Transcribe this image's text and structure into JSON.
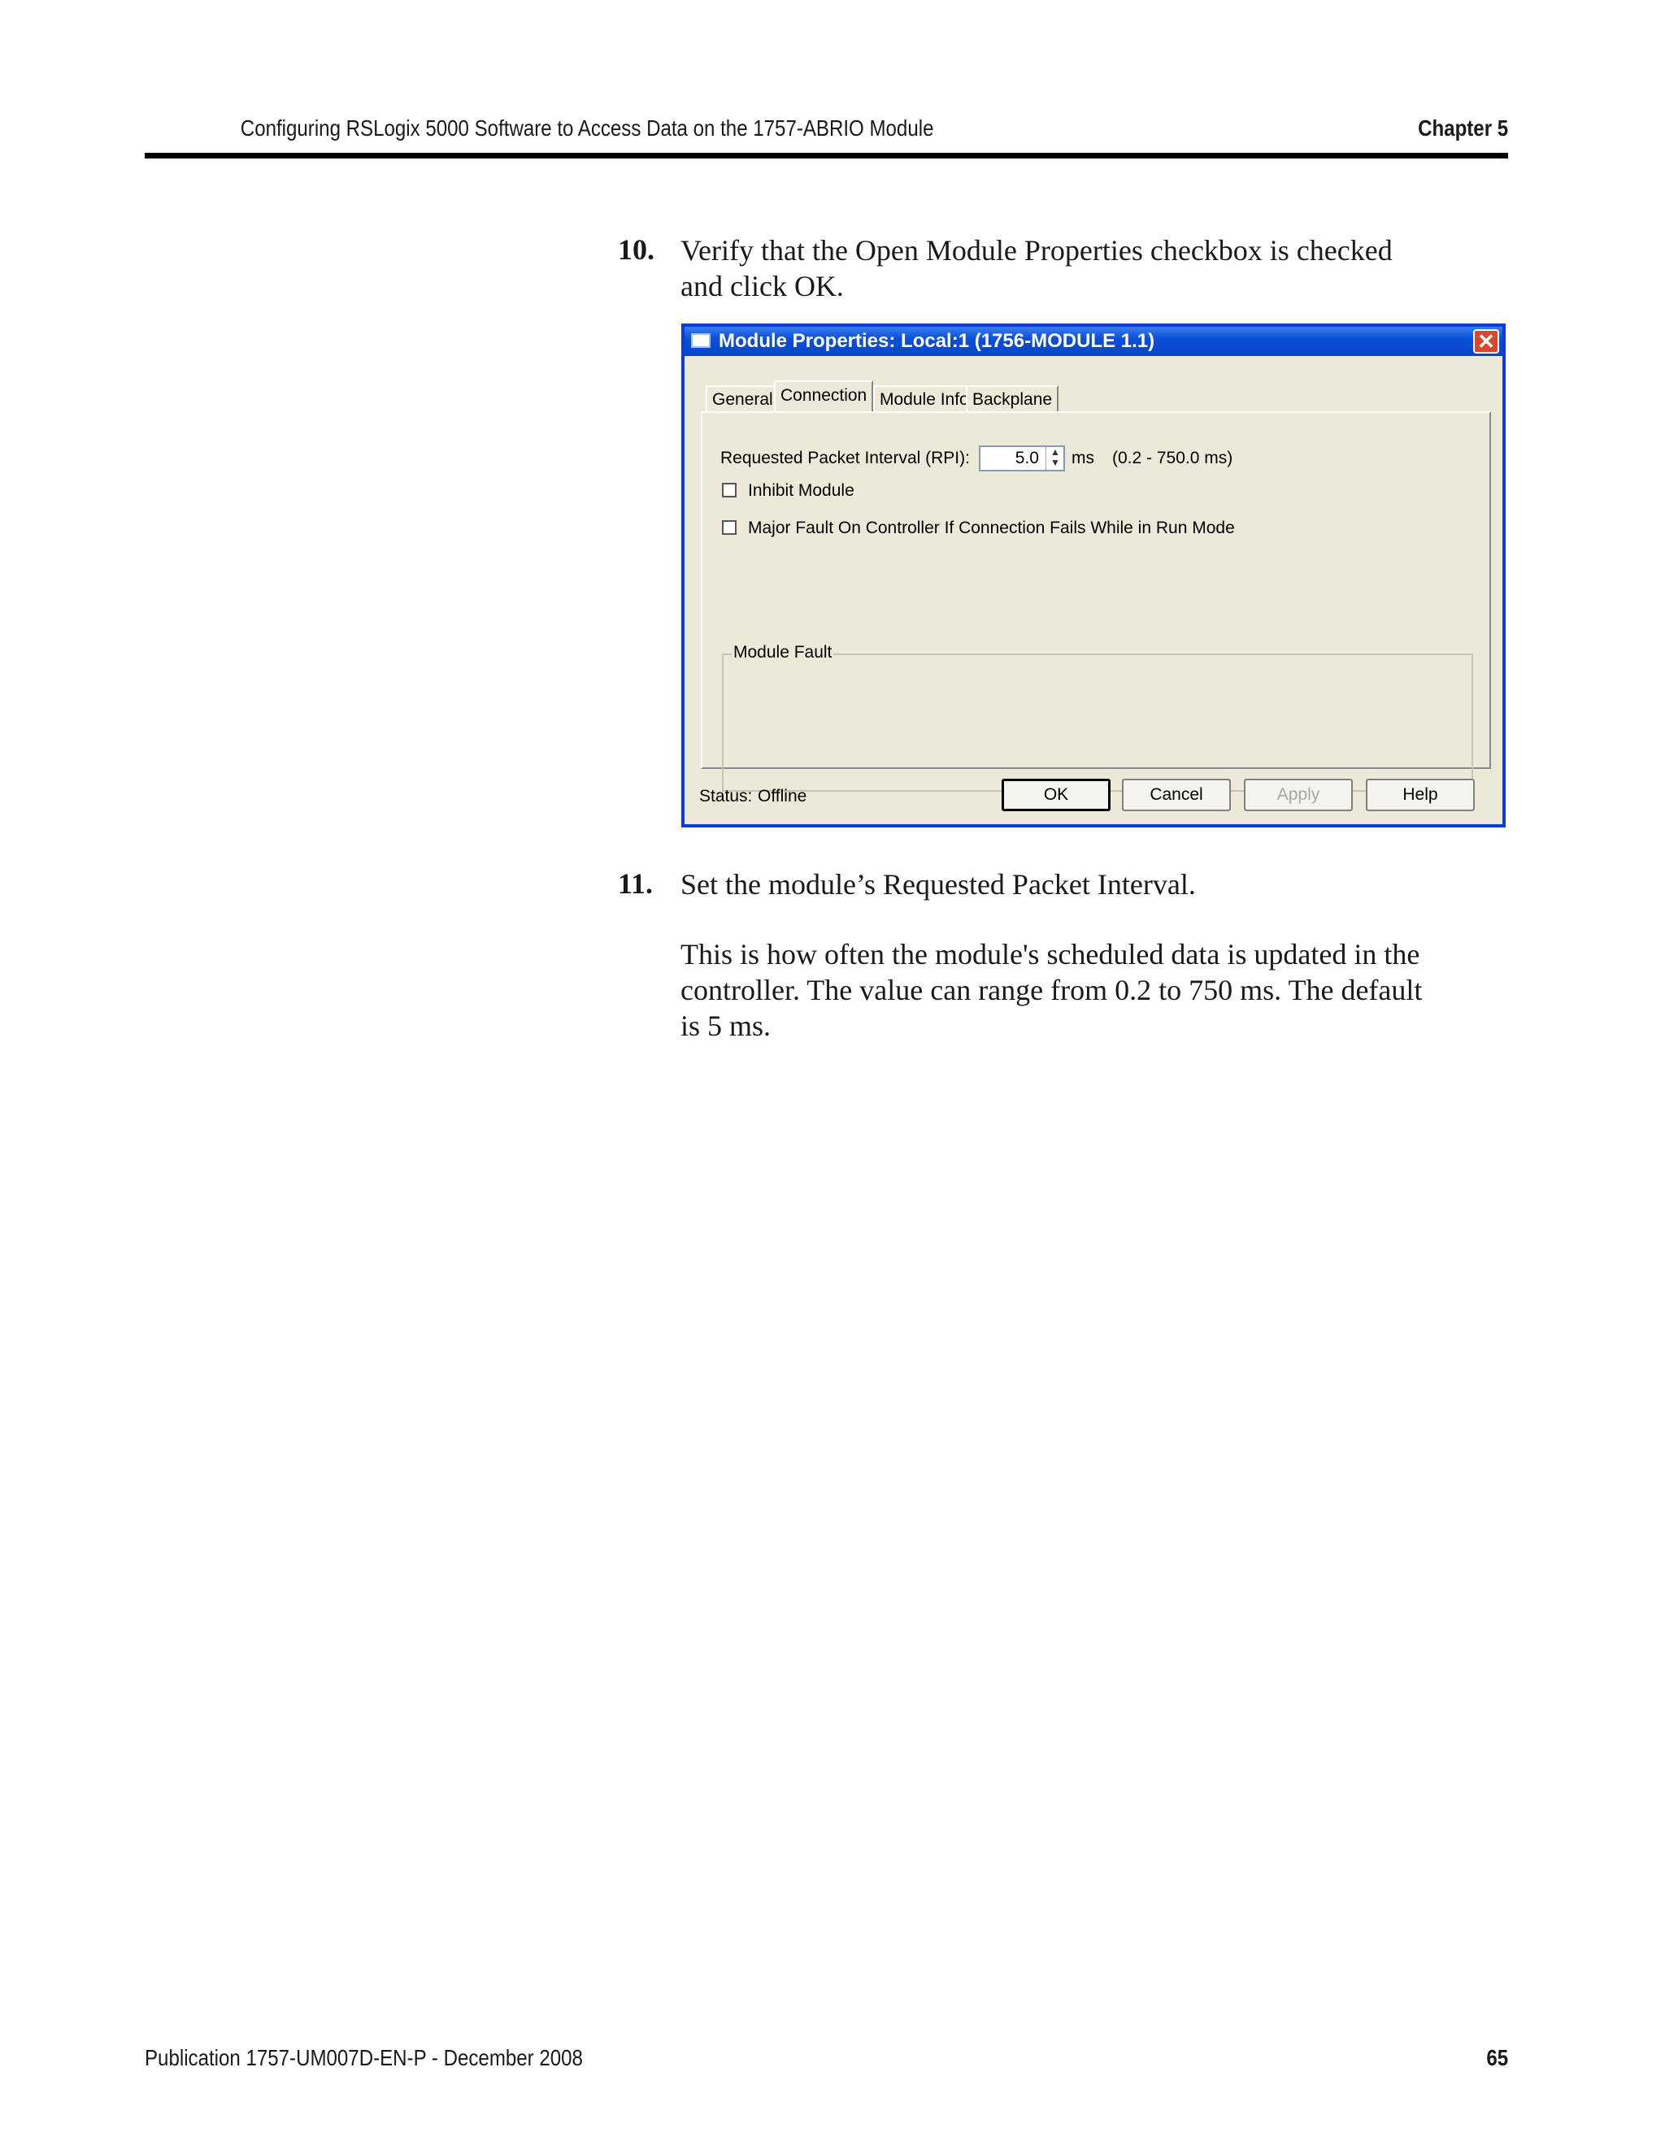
{
  "header": {
    "title": "Configuring RSLogix 5000 Software to Access Data on the 1757-ABRIO Module",
    "chapter": "Chapter 5"
  },
  "steps": [
    {
      "number": "10.",
      "lines": [
        "Verify that the Open Module Properties checkbox is checked",
        "and click OK."
      ]
    },
    {
      "number": "11.",
      "lines": [
        "Set the module’s Requested Packet Interval."
      ]
    }
  ],
  "paragraph": [
    "This is how often the module's scheduled data is updated in the",
    "controller. The value can range from 0.2 to 750 ms. The default",
    "is 5 ms."
  ],
  "dialog": {
    "title": "Module Properties: Local:1 (1756-MODULE 1.1)",
    "tabs": [
      "General",
      "Connection",
      "Module Info",
      "Backplane"
    ],
    "active_tab": "Connection",
    "rpi_label": "Requested Packet Interval (RPI):",
    "rpi_value": "5.0",
    "rpi_unit": "ms",
    "rpi_range": "(0.2 - 750.0 ms)",
    "inhibit_label": "Inhibit Module",
    "inhibit_checked": false,
    "major_fault_label": "Major Fault On Controller If Connection Fails While in Run Mode",
    "major_fault_checked": false,
    "module_fault_label": "Module Fault",
    "status_label": "Status:",
    "status_value": "Offline",
    "buttons": {
      "ok": "OK",
      "cancel": "Cancel",
      "apply": "Apply",
      "help": "Help"
    }
  },
  "footer": {
    "publication": "Publication 1757-UM007D-EN-P - December 2008",
    "page": "65"
  }
}
